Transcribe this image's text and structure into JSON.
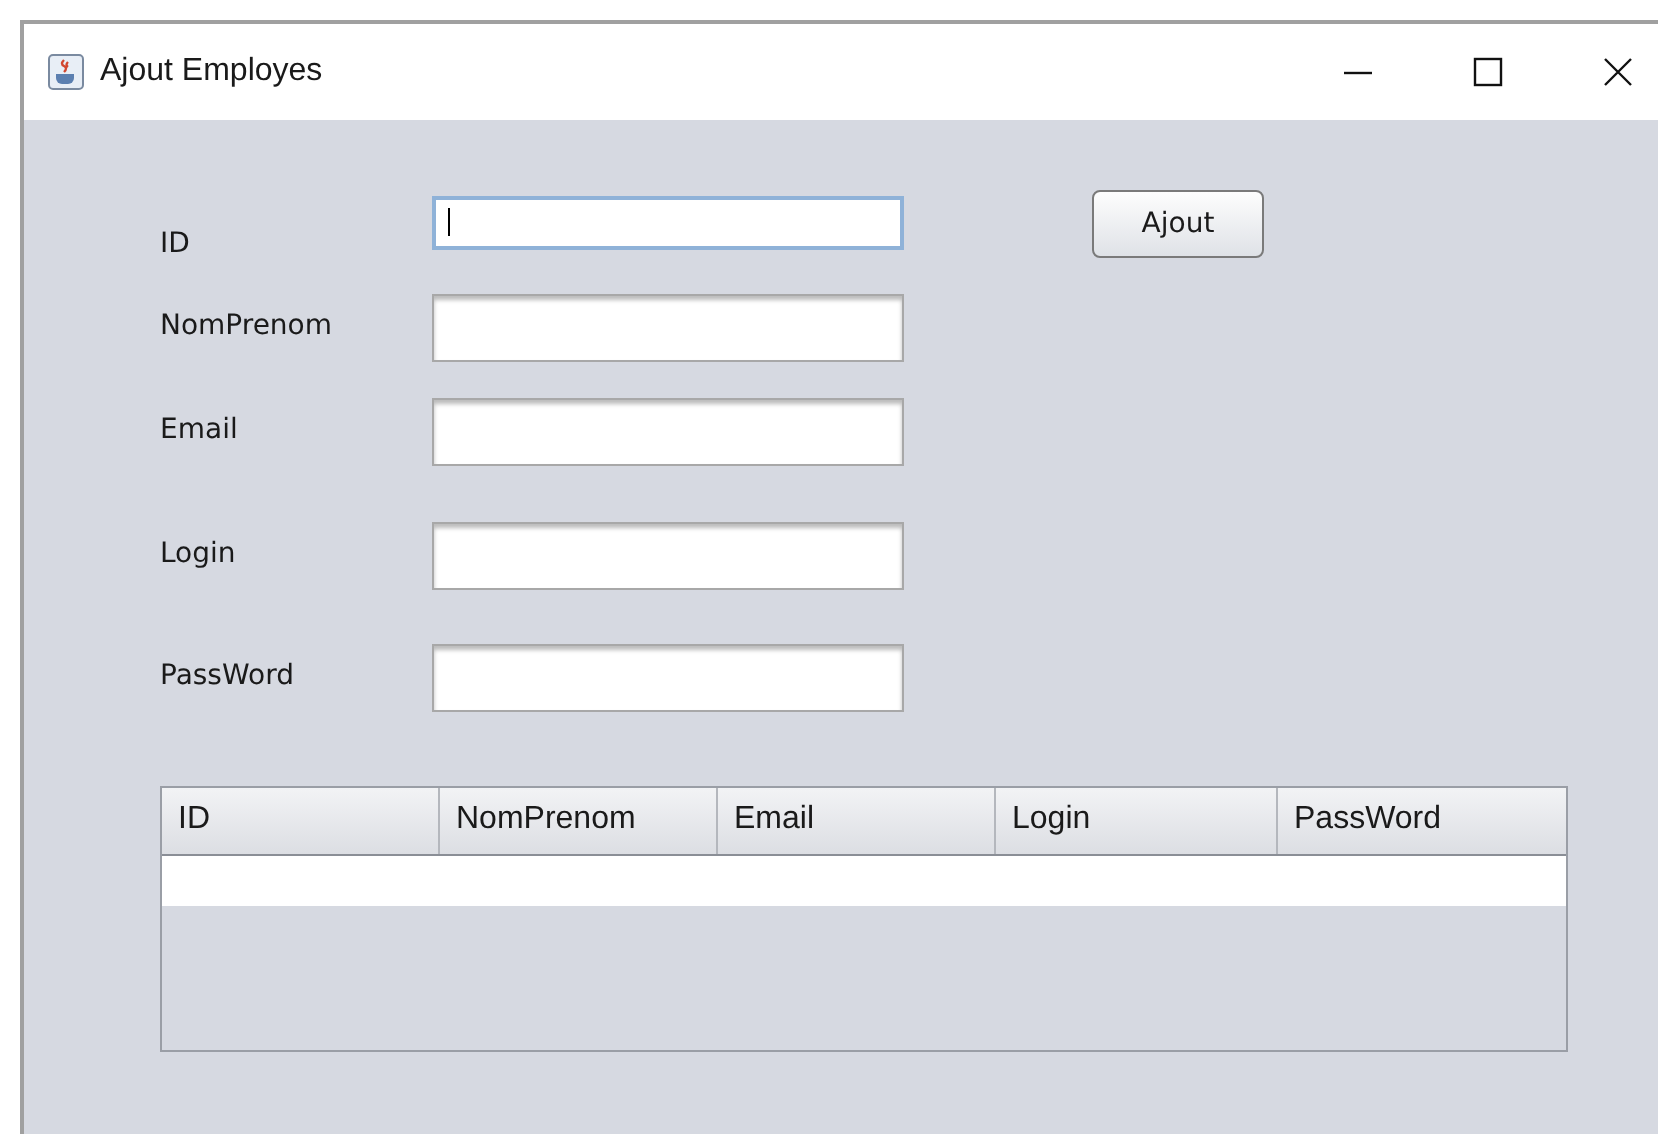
{
  "window": {
    "title": "Ajout Employes"
  },
  "fields": [
    {
      "label": "ID",
      "focused": true
    },
    {
      "label": "NomPrenom",
      "focused": false
    },
    {
      "label": "Email",
      "focused": false
    },
    {
      "label": "Login",
      "focused": false
    },
    {
      "label": "PassWord",
      "focused": false
    }
  ],
  "button": "Ajout",
  "table": {
    "columns": [
      "ID",
      "NomPrenom",
      "Email",
      "Login",
      "PassWord"
    ]
  }
}
